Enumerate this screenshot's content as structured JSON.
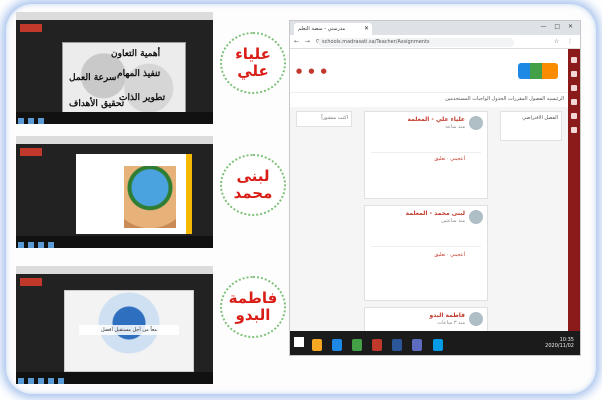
{
  "badges": {
    "first": {
      "line1": "علياء",
      "line2": "علي"
    },
    "second": {
      "line1": "لبنى",
      "line2": "محمد"
    },
    "third": {
      "line1": "فاطمة",
      "line2": "البدو"
    }
  },
  "slide1": {
    "texts": [
      "أهمية التعاون",
      "تنفيذ المهام",
      "سرعة العمل",
      "تطوير الذات",
      "تحقيق الأهداف"
    ]
  },
  "slide3": {
    "caption": "معاً من أجل مستقبل أفضل"
  },
  "browser": {
    "tab_title": "مدرستي - منصة التعلم",
    "url": "schools.madrasati.sa/Teacher/Assignments",
    "nav_icons": "← → ⟳",
    "ext_icons": "☆ ⋮",
    "window_controls": "— □ ✕",
    "menu": "الرئيسية  الفصول  المقررات  الجدول  الواجبات  المستخدمين",
    "side_card": "الفصل الافتراضي",
    "left_card": "اكتب منشوراً",
    "posts": [
      {
        "author": "علياء علي - المعلمة",
        "sub": "منذ ساعة",
        "action": "أعجبني · تعليق"
      },
      {
        "author": "لبنى محمد - المعلمة",
        "sub": "منذ ساعتين",
        "action": "أعجبني · تعليق"
      },
      {
        "author": "فاطمة البدو",
        "sub": "منذ ٣ ساعات",
        "action": ""
      }
    ],
    "clock": {
      "time": "10:35",
      "date": "2020/11/02"
    }
  },
  "colors": {
    "badge_text": "#d91e18",
    "badge_border": "#7ec27a",
    "site_red": "#8b1a1a",
    "frame_glow": "#5a8cdc"
  }
}
